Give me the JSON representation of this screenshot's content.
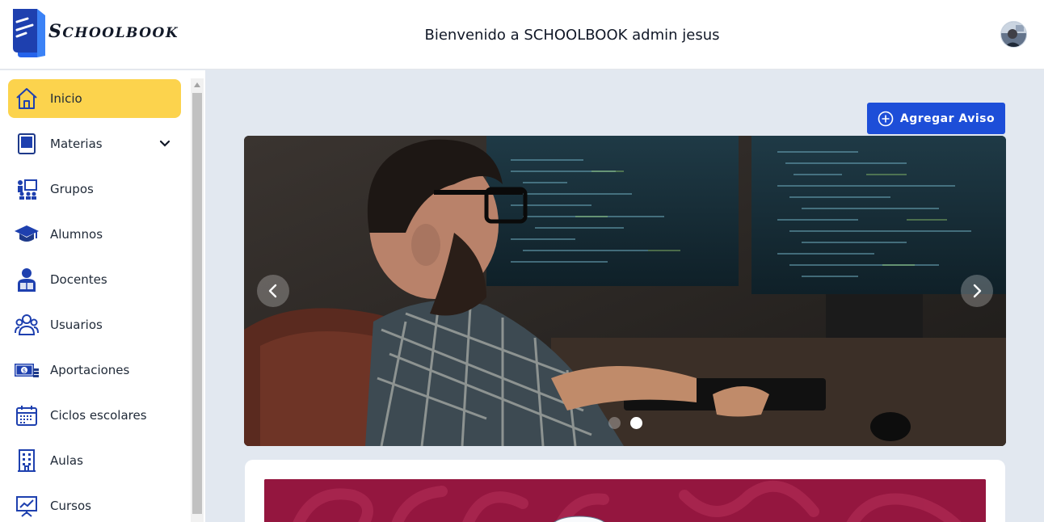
{
  "header": {
    "logo_first": "S",
    "logo_rest": "CHOOLBOOK",
    "welcome": "Bienvenido a SCHOOLBOOK admin jesus"
  },
  "sidebar": {
    "items": [
      {
        "label": "Inicio",
        "icon": "home-icon",
        "active": true
      },
      {
        "label": "Materias",
        "icon": "book-icon",
        "has_submenu": true
      },
      {
        "label": "Grupos",
        "icon": "classroom-icon"
      },
      {
        "label": "Alumnos",
        "icon": "graduation-cap-icon"
      },
      {
        "label": "Docentes",
        "icon": "teacher-icon"
      },
      {
        "label": "Usuarios",
        "icon": "users-icon"
      },
      {
        "label": "Aportaciones",
        "icon": "money-icon"
      },
      {
        "label": "Ciclos escolares",
        "icon": "calendar-icon"
      },
      {
        "label": "Aulas",
        "icon": "building-icon"
      },
      {
        "label": "Cursos",
        "icon": "presentation-chart-icon"
      }
    ]
  },
  "main": {
    "add_button_label": "Agregar Aviso",
    "carousel": {
      "slide_count": 2,
      "active_slide": 2
    }
  },
  "colors": {
    "active_nav": "#fcd34d",
    "primary": "#1d4ed8",
    "icon_blue": "#1e40af",
    "banner": "#94163f"
  }
}
